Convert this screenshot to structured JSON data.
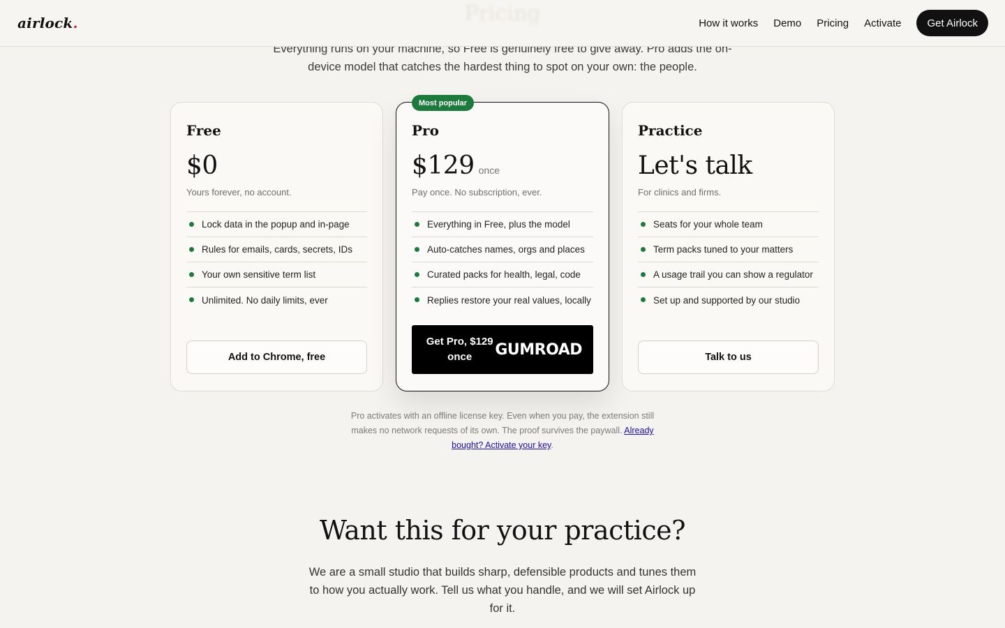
{
  "header": {
    "logo": "airlock",
    "logo_dot": ".",
    "ghost_heading": "Pricing",
    "nav": [
      "How it works",
      "Demo",
      "Pricing",
      "Activate"
    ],
    "cta": "Get Airlock"
  },
  "intro": "Everything runs on your machine, so Free is genuinely free to give away. Pro adds the on-device model that catches the hardest thing to spot on your own: the people.",
  "plans": [
    {
      "name": "Free",
      "price": "$0",
      "price_suffix": "",
      "tagline": "Yours forever, no account.",
      "features": [
        "Lock data in the popup and in-page",
        "Rules for emails, cards, secrets, IDs",
        "Your own sensitive term list",
        "Unlimited. No daily limits, ever"
      ],
      "button": "Add to Chrome, free"
    },
    {
      "name": "Pro",
      "badge": "Most popular",
      "price": "$129",
      "price_suffix": "once",
      "tagline": "Pay once. No subscription, ever.",
      "features": [
        "Everything in Free, plus the model",
        "Auto-catches names, orgs and places",
        "Curated packs for health, legal, code",
        "Replies restore your real values, locally"
      ],
      "button": "Get Pro, $129 once",
      "button_brand": "GUMROAD"
    },
    {
      "name": "Practice",
      "price": "Let's talk",
      "price_suffix": "",
      "tagline": "For clinics and firms.",
      "features": [
        "Seats for your whole team",
        "Term packs tuned to your matters",
        "A usage trail you can show a regulator",
        "Set up and supported by our studio"
      ],
      "button": "Talk to us"
    }
  ],
  "note": {
    "text": "Pro activates with an offline license key. Even when you pay, the extension still makes no network requests of its own. The proof survives the paywall.",
    "link": "Already bought? Activate your key",
    "end": "."
  },
  "cta_section": {
    "title": "Want this for your practice?",
    "body": "We are a small studio that builds sharp, defensible products and tunes them to how you actually work. Tell us what you handle, and we will set Airlock up for it."
  },
  "colors": {
    "background": "#f5f3ef",
    "accent_green": "#1d7a3d",
    "logo_dot": "#d21f3c",
    "primary_button": "#111111"
  }
}
